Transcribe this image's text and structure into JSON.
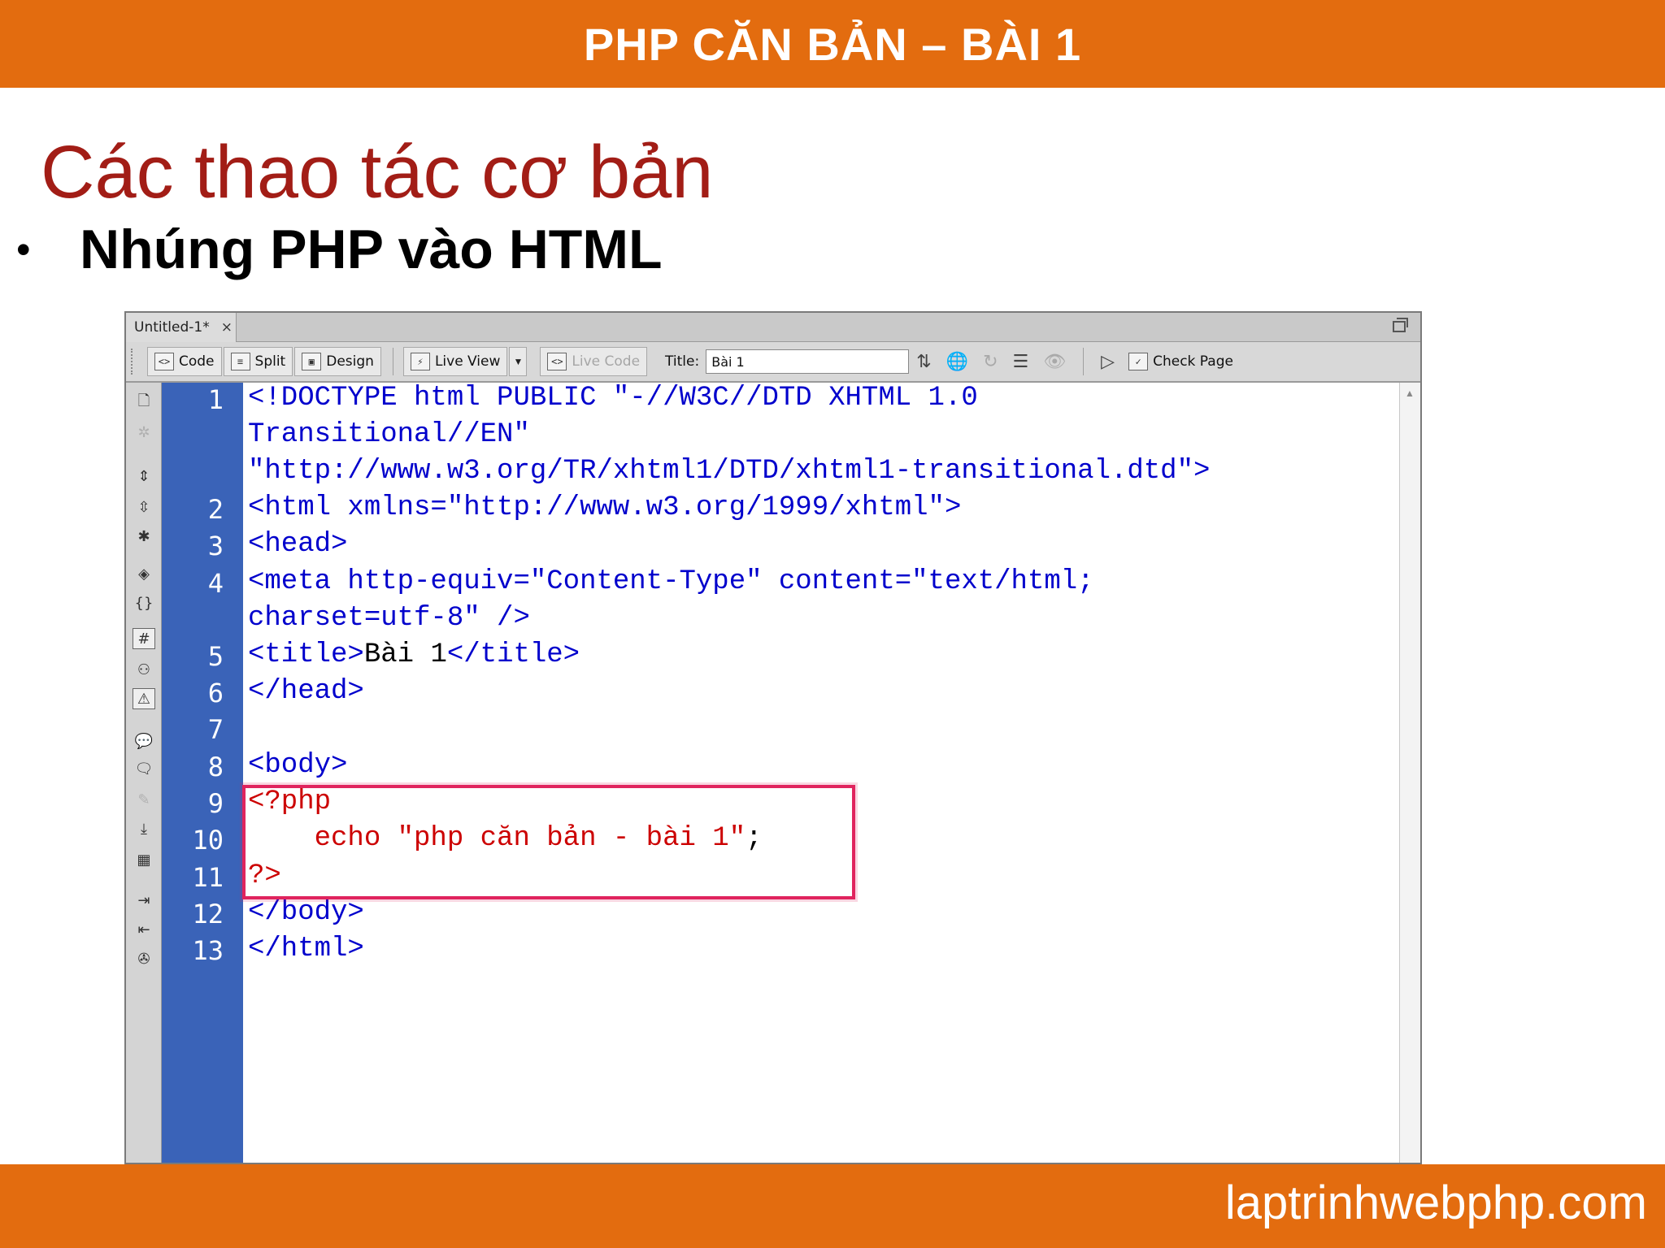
{
  "header": {
    "title": "PHP CĂN BẢN – BÀI 1"
  },
  "slide": {
    "heading": "Các thao tác cơ bản",
    "bullet_marker": "•",
    "bullet": "Nhúng PHP vào HTML"
  },
  "editor": {
    "tab_label": "Untitled-1*",
    "tab_close": "×",
    "toolbar": {
      "code": "Code",
      "split": "Split",
      "design": "Design",
      "live_view": "Live View",
      "live_code": "Live Code",
      "title_label": "Title:",
      "title_value": "Bài 1",
      "check_page": "Check Page"
    },
    "line_numbers": [
      "1",
      "2",
      "3",
      "4",
      "5",
      "6",
      "7",
      "8",
      "9",
      "10",
      "11",
      "12",
      "13"
    ],
    "code": {
      "l1a": "<!DOCTYPE html PUBLIC \"-//W3C//DTD XHTML 1.0",
      "l1b": "Transitional//EN\"",
      "l1c": "\"http://www.w3.org/TR/xhtml1/DTD/xhtml1-transitional.dtd\">",
      "l2": "<html xmlns=\"http://www.w3.org/1999/xhtml\">",
      "l3": "<head>",
      "l4a": "<meta http-equiv=\"Content-Type\" content=\"text/html;",
      "l4b": "charset=utf-8\" />",
      "l5_open": "<title>",
      "l5_text": "Bài 1",
      "l5_close": "</title>",
      "l6": "</head>",
      "l8": "<body>",
      "l9": "<?php",
      "l10_code": "    echo \"php căn bản - bài 1\"",
      "l10_semi": ";",
      "l11": "?>",
      "l12": "</body>",
      "l13": "</html>"
    }
  },
  "footer": {
    "url": "laptrinhwebphp.com"
  },
  "colors": {
    "brand_orange": "#e36c0f",
    "heading_red": "#a21d16",
    "gutter_blue": "#3a63b8",
    "highlight": "#e0245e"
  }
}
